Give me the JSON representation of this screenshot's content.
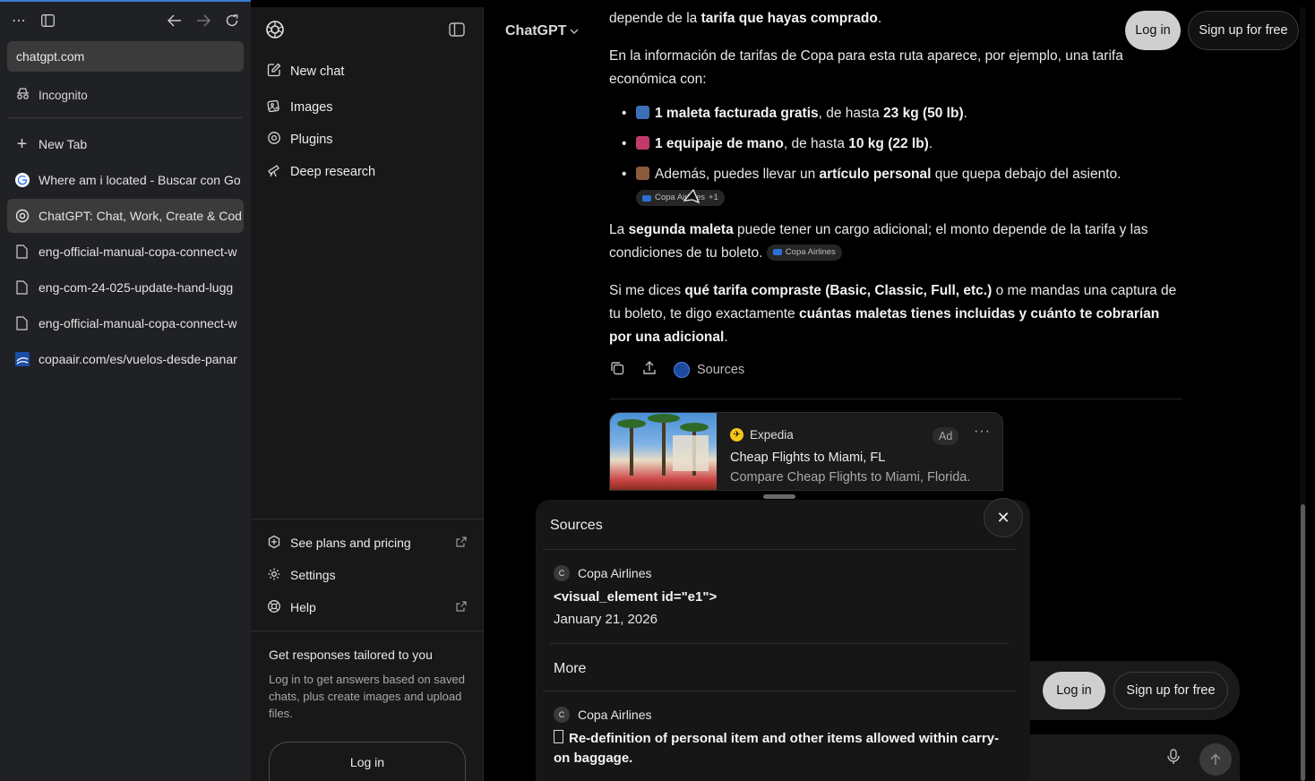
{
  "browser": {
    "address": "chatgpt.com",
    "incognito_label": "Incognito",
    "tabs": [
      {
        "label": "New Tab"
      },
      {
        "label": "Where am i located - Buscar con Go"
      },
      {
        "label": "ChatGPT: Chat, Work, Create & Cod"
      },
      {
        "label": "eng-official-manual-copa-connect-w"
      },
      {
        "label": "eng-com-24-025-update-hand-lugg"
      },
      {
        "label": "eng-official-manual-copa-connect-w"
      },
      {
        "label": "copaair.com/es/vuelos-desde-panar"
      }
    ]
  },
  "sidebar": {
    "items": [
      {
        "label": "New chat"
      },
      {
        "label": "Images"
      },
      {
        "label": "Plugins"
      },
      {
        "label": "Deep research"
      }
    ],
    "bottom": [
      {
        "label": "See plans and pricing"
      },
      {
        "label": "Settings"
      },
      {
        "label": "Help"
      }
    ],
    "promo_title": "Get responses tailored to you",
    "promo_text": "Log in to get answers based on saved chats, plus create images and upload files.",
    "promo_login": "Log in"
  },
  "header": {
    "model": "ChatGPT",
    "login": "Log in",
    "signup": "Sign up for free"
  },
  "message": {
    "p0_a": "depende de la ",
    "p0_b": "tarifa que hayas comprado",
    "p0_c": ".",
    "p1": "En la información de tarifas de Copa para esta ruta aparece, por ejemplo, una tarifa económica con:",
    "li1_b1": "1 maleta facturada gratis",
    "li1_t": ", de hasta ",
    "li1_b2": "23 kg (50 lb)",
    "li1_e": ".",
    "li2_b1": "1 equipaje de mano",
    "li2_t": ", de hasta ",
    "li2_b2": "10 kg (22 lb)",
    "li2_e": ".",
    "li3_t1": "Además, puedes llevar un ",
    "li3_b": "artículo personal",
    "li3_t2": " que quepa debajo del asiento.",
    "chip1": "Copa Airlines",
    "chip1_extra": "+1",
    "p2_a": "La ",
    "p2_b": "segunda maleta",
    "p2_c": " puede tener un cargo adicional; el monto depende de la tarifa y las condiciones de tu boleto.",
    "chip2": "Copa Airlines",
    "p3_a": "Si me dices ",
    "p3_b": "qué tarifa compraste (Basic, Classic, Full, etc.)",
    "p3_c": " o me mandas una captura de tu boleto, te digo exactamente ",
    "p3_d": "cuántas maletas tienes incluidas y cuánto te cobrarían por una adicional",
    "p3_e": ".",
    "sources_label": "Sources"
  },
  "ad": {
    "brand": "Expedia",
    "badge": "Ad",
    "more": "···",
    "title": "Cheap Flights to Miami, FL",
    "desc": "Compare Cheap Flights to Miami, Florida."
  },
  "composer": {
    "login": "Log in",
    "signup": "Sign up for free"
  },
  "sources_panel": {
    "title": "Sources",
    "first": {
      "site": "Copa Airlines",
      "badge": "C",
      "title": "<visual_element id=\"e1\">",
      "date": "January 21, 2026"
    },
    "more_label": "More",
    "second": {
      "site": "Copa Airlines",
      "badge": "C",
      "title": "Re-definition of personal item and other items allowed within carry-on baggage."
    },
    "close": "✕"
  }
}
